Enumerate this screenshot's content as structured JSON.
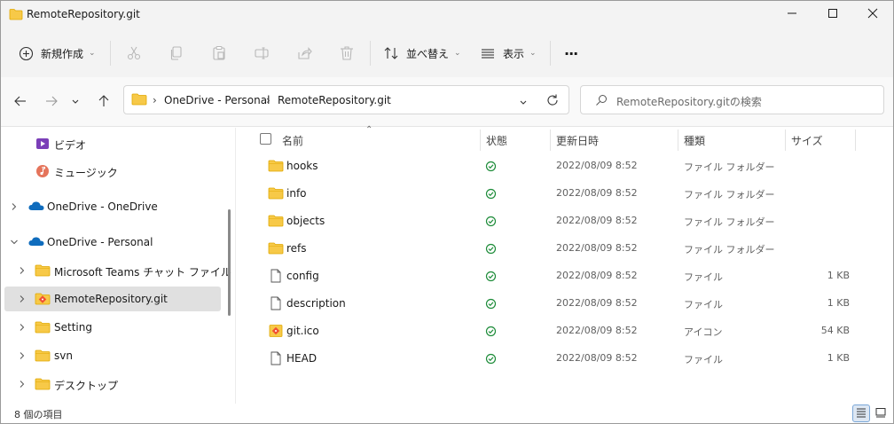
{
  "window": {
    "title": "RemoteRepository.git",
    "controls": {
      "minimize": "minimize",
      "maximize": "maximize",
      "close": "close"
    }
  },
  "commandbar": {
    "new_label": "新規作成",
    "sort_label": "並べ替え",
    "view_label": "表示",
    "more_label": "···",
    "icons": [
      "cut-icon",
      "copy-icon",
      "paste-icon",
      "rename-icon",
      "share-icon",
      "delete-icon"
    ]
  },
  "address": {
    "breadcrumbs": [
      "OneDrive - Personal",
      "RemoteRepository.git"
    ],
    "search_placeholder": "RemoteRepository.gitの検索"
  },
  "nav": {
    "items": [
      {
        "label": "ビデオ",
        "icon": "video-icon",
        "expander": "",
        "indent": 1,
        "selected": false
      },
      {
        "label": "ミュージック",
        "icon": "music-icon",
        "expander": "",
        "indent": 1,
        "selected": false
      },
      {
        "label": "OneDrive - OneDrive",
        "icon": "cloud-icon",
        "expander": "collapsed",
        "indent": 0,
        "selected": false
      },
      {
        "label": "OneDrive - Personal",
        "icon": "cloud-icon",
        "expander": "expanded",
        "indent": 0,
        "selected": false
      },
      {
        "label": "Microsoft Teams チャット ファイル",
        "icon": "folder-icon",
        "expander": "collapsed",
        "indent": 1,
        "selected": false
      },
      {
        "label": "RemoteRepository.git",
        "icon": "git-folder-icon",
        "expander": "collapsed",
        "indent": 1,
        "selected": true
      },
      {
        "label": "Setting",
        "icon": "folder-icon",
        "expander": "collapsed",
        "indent": 1,
        "selected": false
      },
      {
        "label": "svn",
        "icon": "folder-icon",
        "expander": "collapsed",
        "indent": 1,
        "selected": false
      },
      {
        "label": "デスクトップ",
        "icon": "folder-icon",
        "expander": "collapsed",
        "indent": 1,
        "selected": false
      }
    ]
  },
  "filelist": {
    "columns": {
      "name": "名前",
      "status": "状態",
      "modified": "更新日時",
      "type": "種類",
      "size": "サイズ"
    },
    "rows": [
      {
        "name": "hooks",
        "icon": "folder-icon",
        "status": "synced",
        "modified": "2022/08/09 8:52",
        "type": "ファイル フォルダー",
        "size": ""
      },
      {
        "name": "info",
        "icon": "folder-icon",
        "status": "synced",
        "modified": "2022/08/09 8:52",
        "type": "ファイル フォルダー",
        "size": ""
      },
      {
        "name": "objects",
        "icon": "folder-icon",
        "status": "synced",
        "modified": "2022/08/09 8:52",
        "type": "ファイル フォルダー",
        "size": ""
      },
      {
        "name": "refs",
        "icon": "folder-icon",
        "status": "synced",
        "modified": "2022/08/09 8:52",
        "type": "ファイル フォルダー",
        "size": ""
      },
      {
        "name": "config",
        "icon": "file-icon",
        "status": "synced",
        "modified": "2022/08/09 8:52",
        "type": "ファイル",
        "size": "1 KB"
      },
      {
        "name": "description",
        "icon": "file-icon",
        "status": "synced",
        "modified": "2022/08/09 8:52",
        "type": "ファイル",
        "size": "1 KB"
      },
      {
        "name": "git.ico",
        "icon": "ico-file-icon",
        "status": "synced",
        "modified": "2022/08/09 8:52",
        "type": "アイコン",
        "size": "54 KB"
      },
      {
        "name": "HEAD",
        "icon": "file-icon",
        "status": "synced",
        "modified": "2022/08/09 8:52",
        "type": "ファイル",
        "size": "1 KB"
      }
    ]
  },
  "status": {
    "item_count": "8 個の項目"
  },
  "colors": {
    "folder": "#f7c948",
    "folder_dark": "#e0a800",
    "sync_green": "#1e8c3a",
    "onedrive_blue": "#0f6cbd",
    "selection": "#e0e0e0"
  }
}
